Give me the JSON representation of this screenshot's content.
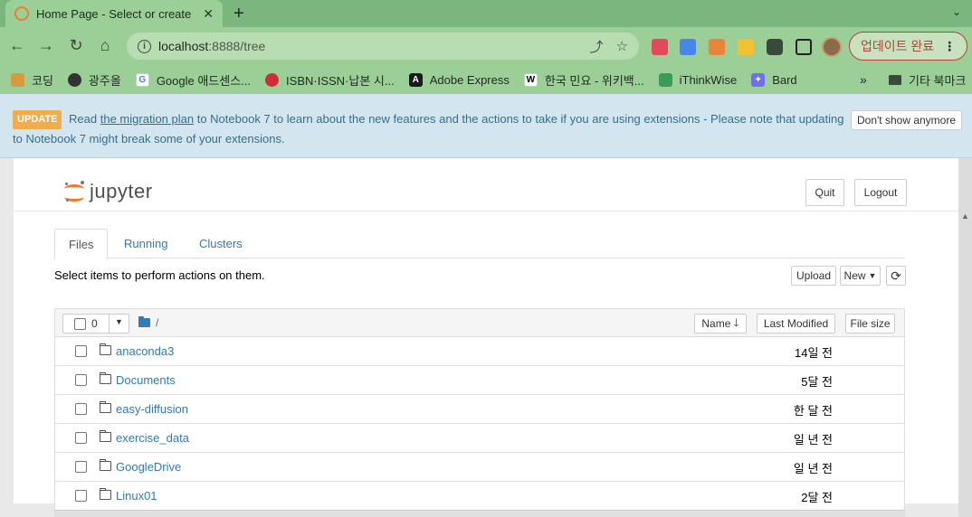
{
  "browser": {
    "tab_title": "Home Page - Select or create",
    "new_tab": "+",
    "url_host": "localhost",
    "url_rest": ":8888/tree",
    "update_button": "업데이트 완료",
    "bookmarks": [
      {
        "label": "코딩",
        "color": "#d99a3c"
      },
      {
        "label": "광주올",
        "color": "#333333"
      },
      {
        "label": "Google 애드센스...",
        "color": "#4285f4"
      },
      {
        "label": "ISBN·ISSN·납본 시...",
        "color": "#cd2e3a"
      },
      {
        "label": "Adobe Express",
        "color": "#1a1a1a"
      },
      {
        "label": "한국 민요 - 위키백...",
        "color": "#ffffff"
      },
      {
        "label": "iThinkWise",
        "color": "#3b9c5a"
      },
      {
        "label": "Bard",
        "color": "#6f6fe8"
      }
    ],
    "other_bookmarks": "기타 북마크"
  },
  "notice": {
    "badge": "UPDATE",
    "text_before": "Read",
    "link": "the migration plan",
    "text_after": "to Notebook 7 to learn about the new features and the actions to take if you are using extensions - Please note that updating to Notebook 7 might break some of your extensions.",
    "dismiss": "Don't show anymore"
  },
  "header": {
    "logo": "jupyter",
    "quit": "Quit",
    "logout": "Logout"
  },
  "tabs": [
    "Files",
    "Running",
    "Clusters"
  ],
  "hint": "Select items to perform actions on them.",
  "actions": {
    "upload": "Upload",
    "new": "New",
    "refresh": "⟳"
  },
  "list": {
    "selected_count": "0",
    "breadcrumb": "/",
    "col_name": "Name",
    "col_modified": "Last Modified",
    "col_size": "File size",
    "rows": [
      {
        "name": "anaconda3",
        "modified": "14일 전"
      },
      {
        "name": "Documents",
        "modified": "5달 전"
      },
      {
        "name": "easy-diffusion",
        "modified": "한 달 전"
      },
      {
        "name": "exercise_data",
        "modified": "일 년 전"
      },
      {
        "name": "GoogleDrive",
        "modified": "일 년 전"
      },
      {
        "name": "Linux01",
        "modified": "2달 전"
      }
    ]
  }
}
